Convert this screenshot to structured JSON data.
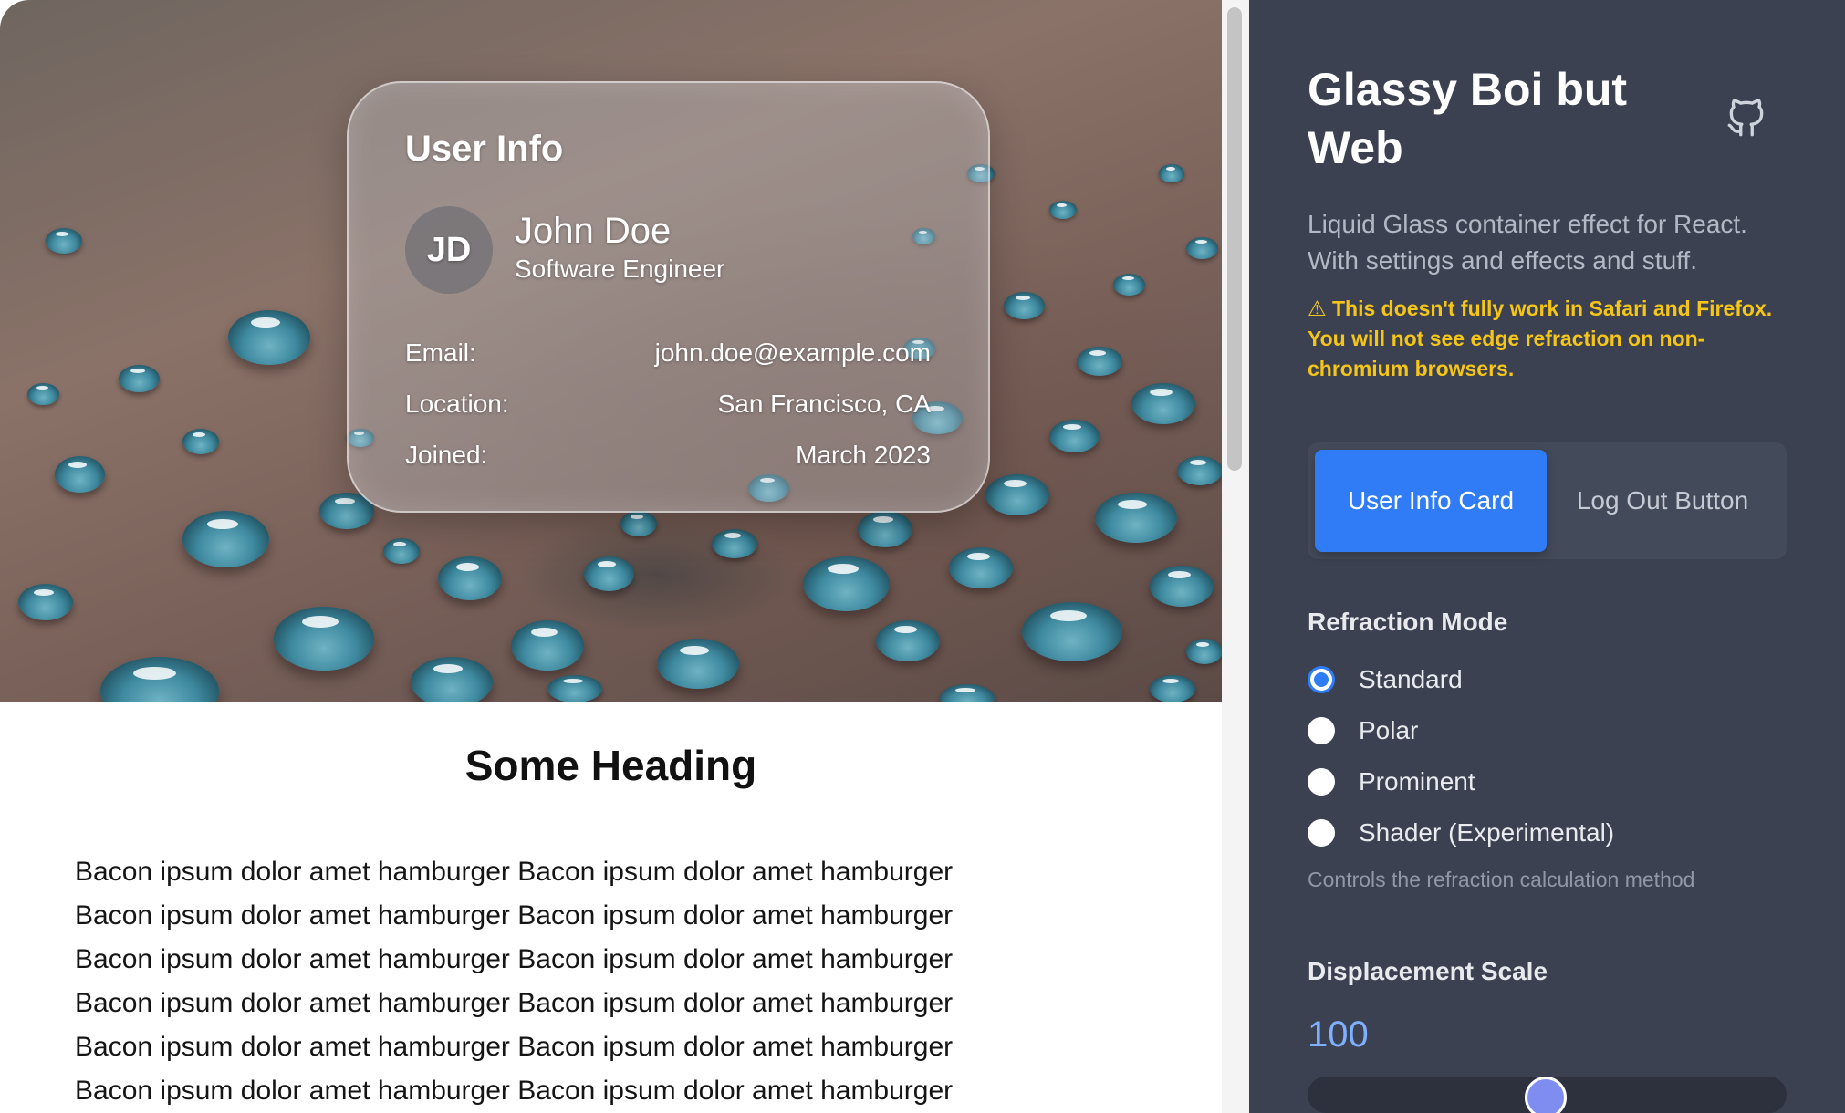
{
  "glass_card": {
    "title": "User Info",
    "avatar_initials": "JD",
    "name": "John Doe",
    "role": "Software Engineer",
    "rows": [
      {
        "label": "Email:",
        "value": "john.doe@example.com"
      },
      {
        "label": "Location:",
        "value": "San Francisco, CA"
      },
      {
        "label": "Joined:",
        "value": "March 2023"
      }
    ]
  },
  "article": {
    "heading": "Some Heading",
    "lines": [
      "Bacon ipsum dolor amet hamburger Bacon ipsum dolor amet hamburger",
      "Bacon ipsum dolor amet hamburger Bacon ipsum dolor amet hamburger",
      "Bacon ipsum dolor amet hamburger Bacon ipsum dolor amet hamburger",
      "Bacon ipsum dolor amet hamburger Bacon ipsum dolor amet hamburger",
      "Bacon ipsum dolor amet hamburger Bacon ipsum dolor amet hamburger",
      "Bacon ipsum dolor amet hamburger Bacon ipsum dolor amet hamburger"
    ]
  },
  "panel": {
    "title": "Glassy Boi but Web",
    "github_icon": "github-icon",
    "description": "Liquid Glass container effect for React. With settings and effects and stuff.",
    "warning": "⚠ This doesn't fully work in Safari and Firefox. You will not see edge refraction on non-chromium browsers.",
    "tabs": [
      {
        "label": "User Info Card",
        "active": true
      },
      {
        "label": "Log Out Button",
        "active": false
      }
    ],
    "refraction": {
      "label": "Refraction Mode",
      "options": [
        {
          "label": "Standard",
          "checked": true
        },
        {
          "label": "Polar",
          "checked": false
        },
        {
          "label": "Prominent",
          "checked": false
        },
        {
          "label": "Shader (Experimental)",
          "checked": false
        }
      ],
      "hint": "Controls the refraction calculation method"
    },
    "displacement": {
      "label": "Displacement Scale",
      "value": "100"
    },
    "colors": {
      "panel_bg": "#3b4150",
      "accent": "#2f7cf6",
      "warning": "#f5c518",
      "value_text": "#7fb0ff"
    }
  }
}
